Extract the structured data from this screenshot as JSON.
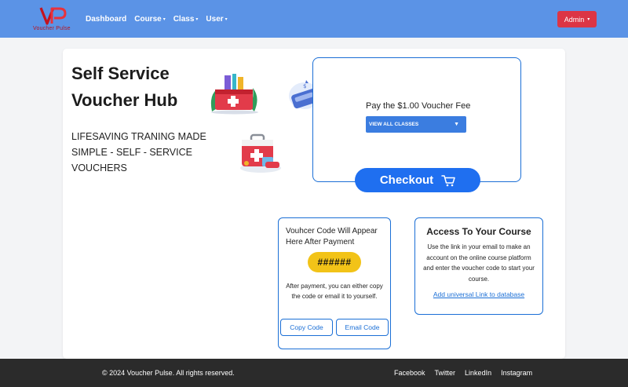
{
  "navbar": {
    "brand_text": "Voucher Pulse",
    "items": [
      {
        "label": "Dashboard",
        "has_dropdown": false
      },
      {
        "label": "Course",
        "has_dropdown": true
      },
      {
        "label": "Class",
        "has_dropdown": true
      },
      {
        "label": "User",
        "has_dropdown": true
      }
    ],
    "admin_label": "Admin",
    "caret": "▾"
  },
  "hero": {
    "title": "Self Service Voucher Hub",
    "subtitle": "LIFESAVING TRANING MADE SIMPLE - SELF - SERVICE VOUCHERS"
  },
  "payment": {
    "fee_text": "Pay the $1.00 Voucher Fee",
    "select_value": "VIEW ALL CLASSES",
    "select_arrow": "▼",
    "checkout_label": "Checkout"
  },
  "voucher": {
    "title": "Vouhcer Code Will Appear Here After Payment",
    "code": "######",
    "note": "After payment, you can either copy the code or email it to yourself.",
    "copy_label": "Copy Code",
    "email_label": "Email Code"
  },
  "access": {
    "title": "Access To Your Course",
    "text": "Use the link in your email to make an account on the online course platform and enter the voucher code to start your course.",
    "link": "Add universal Link to database"
  },
  "footer": {
    "copyright": "© 2024 Voucher Pulse. All rights reserved.",
    "links": [
      "Facebook",
      "Twitter",
      "LinkedIn",
      "Instagram"
    ]
  },
  "colors": {
    "navbar": "#5b93e6",
    "admin": "#dc3545",
    "accent": "#1f6ff0",
    "code_pill": "#f2c318",
    "footer": "#2b2b2b"
  }
}
